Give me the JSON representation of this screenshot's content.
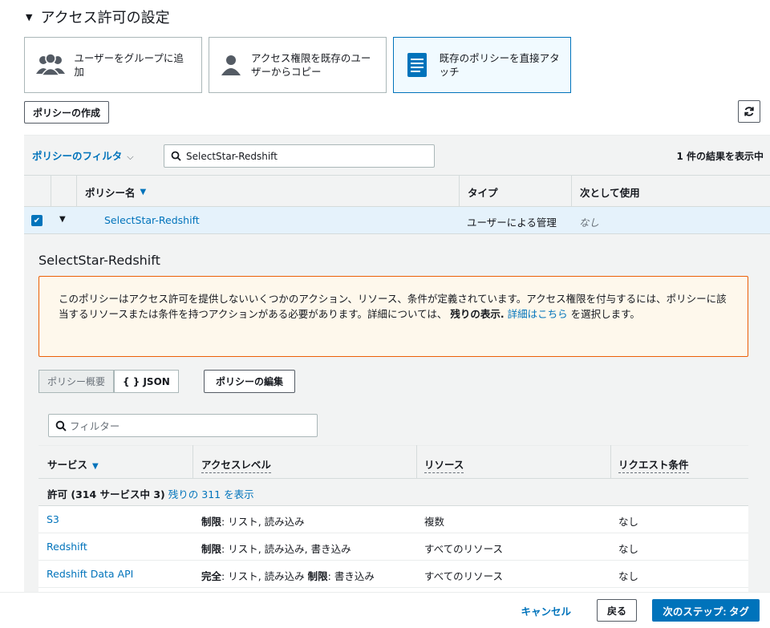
{
  "section": {
    "title": "アクセス許可の設定"
  },
  "options": [
    {
      "label": "ユーザーをグループに追加",
      "icon": "group-icon"
    },
    {
      "label": "アクセス権限を既存のユーザーからコピー",
      "icon": "user-icon"
    },
    {
      "label": "既存のポリシーを直接アタッチ",
      "icon": "document-icon"
    }
  ],
  "toolbar": {
    "create_policy": "ポリシーの作成",
    "refresh_icon": "refresh-icon"
  },
  "filter": {
    "label": "ポリシーのフィルタ",
    "search_value": "SelectStar-Redshift",
    "result_count": "1 件の結果を表示中"
  },
  "table": {
    "headers": {
      "name": "ポリシー名",
      "type": "タイプ",
      "used_as": "次として使用"
    },
    "row": {
      "name": "SelectStar-Redshift",
      "type": "ユーザーによる管理",
      "used_as": "なし"
    }
  },
  "detail": {
    "title": "SelectStar-Redshift",
    "warning": {
      "text": "このポリシーはアクセス許可を提供しないいくつかのアクション、リソース、条件が定義されています。アクセス権限を付与するには、ポリシーに該当するリソースまたは条件を持つアクションがある必要があります。詳細については、",
      "bold": "残りの表示.",
      "link": "詳細はこちら",
      "tail": " を選択します。"
    },
    "tabs": {
      "summary": "ポリシー概要",
      "json": "{ } JSON"
    },
    "edit_policy": "ポリシーの編集",
    "summary_filter_placeholder": "フィルター",
    "summary_headers": {
      "service": "サービス",
      "access_level": "アクセスレベル",
      "resource": "リソース",
      "condition": "リクエスト条件"
    },
    "allowed": {
      "label": "許可 (314 サービス中 3)",
      "link": "残りの 311 を表示"
    },
    "services": [
      {
        "name": "S3",
        "level_bold": "制限",
        "level": ": リスト, 読み込み",
        "level_bold2": "",
        "level2": "",
        "resource": "複数",
        "condition": "なし"
      },
      {
        "name": "Redshift",
        "level_bold": "制限",
        "level": ": リスト, 読み込み, 書き込み",
        "level_bold2": "",
        "level2": "",
        "resource": "すべてのリソース",
        "condition": "なし"
      },
      {
        "name": "Redshift Data API",
        "level_bold": "完全",
        "level": ": リスト, 読み込み ",
        "level_bold2": "制限",
        "level2": ": 書き込み",
        "resource": "すべてのリソース",
        "condition": "なし"
      }
    ]
  },
  "footer": {
    "cancel": "キャンセル",
    "back": "戻る",
    "next": "次のステップ: タグ"
  }
}
